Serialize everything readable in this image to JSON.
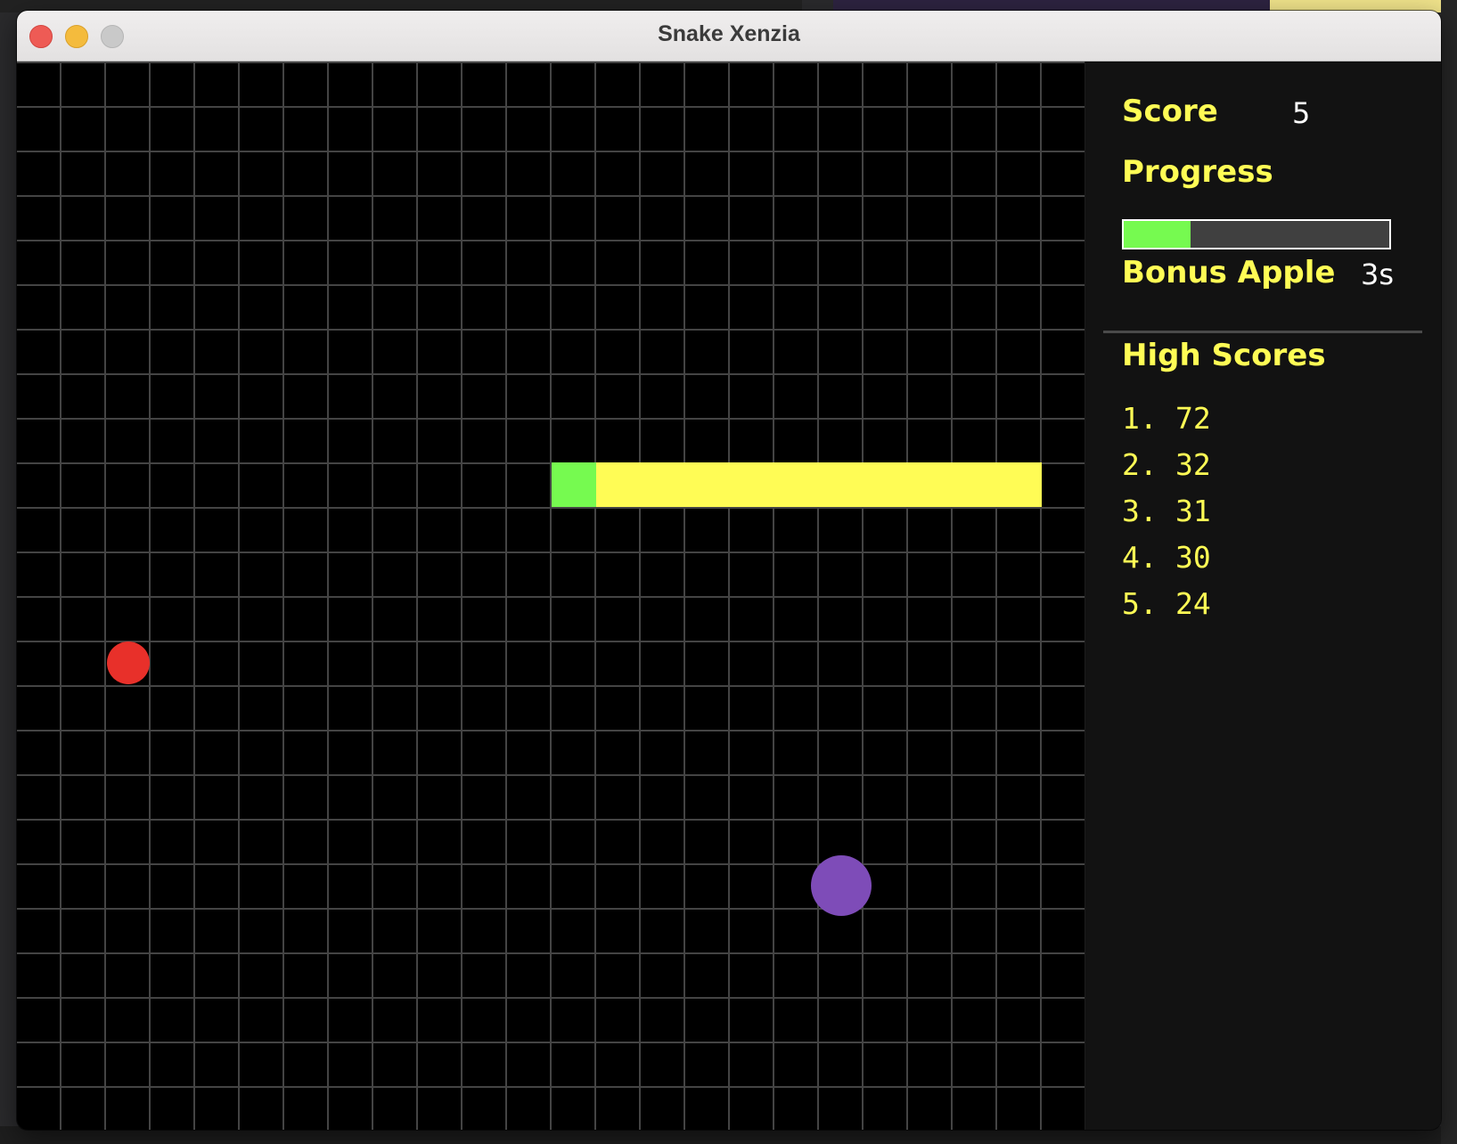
{
  "window": {
    "title": "Snake Xenzia"
  },
  "board": {
    "grid_cols": 24,
    "grid_rows": 24,
    "snake": {
      "head": [
        12,
        9
      ],
      "body": [
        [
          13,
          9
        ],
        [
          14,
          9
        ],
        [
          15,
          9
        ],
        [
          16,
          9
        ],
        [
          17,
          9
        ],
        [
          18,
          9
        ],
        [
          19,
          9
        ],
        [
          20,
          9
        ],
        [
          21,
          9
        ],
        [
          22,
          9
        ]
      ]
    },
    "apple": {
      "cell": [
        2,
        13
      ],
      "color": "#e8302a"
    },
    "bonus_apple": {
      "cell": [
        18,
        18
      ],
      "color": "#7e4cb8"
    },
    "colors": {
      "background": "#000000",
      "grid": "#444444",
      "snake_head": "#76fa50",
      "snake_body": "#fffc55"
    }
  },
  "panel": {
    "score_label": "Score",
    "score_value": "5",
    "progress_label": "Progress",
    "progress_fraction": 0.25,
    "bonus_label": "Bonus Apple",
    "bonus_value": "3s",
    "high_scores_label": "High Scores",
    "high_scores": [
      {
        "rank": "1.",
        "score": "72"
      },
      {
        "rank": "2.",
        "score": "32"
      },
      {
        "rank": "3.",
        "score": "31"
      },
      {
        "rank": "4.",
        "score": "30"
      },
      {
        "rank": "5.",
        "score": "24"
      }
    ],
    "colors": {
      "label": "#fffc55",
      "value": "#ffffff",
      "progress_fill": "#76fa50",
      "progress_track": "#404040"
    }
  }
}
